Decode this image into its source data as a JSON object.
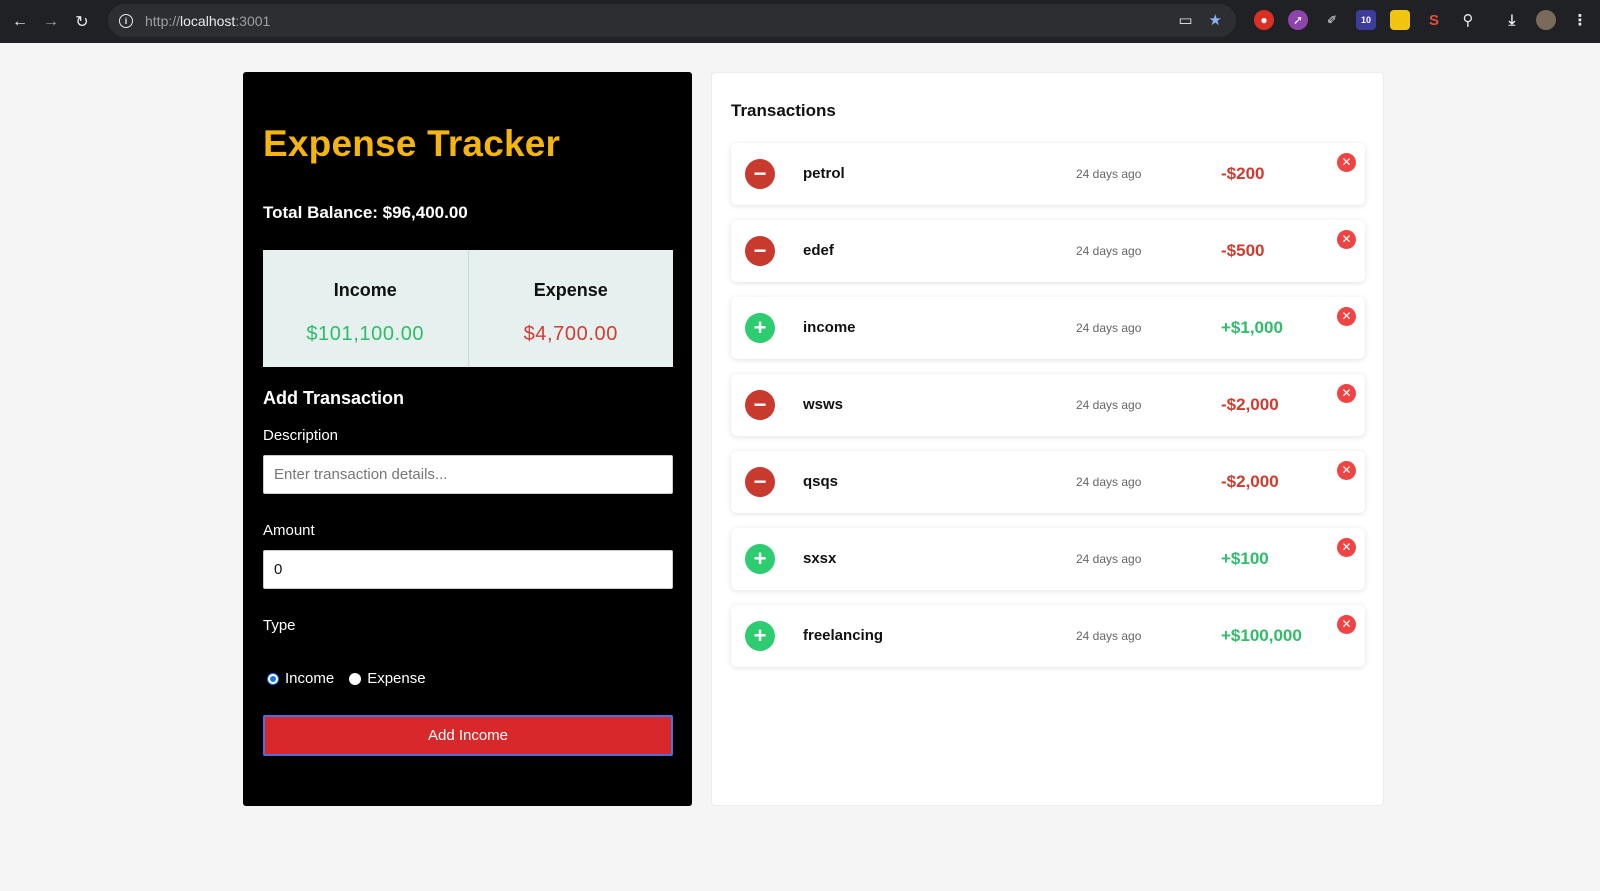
{
  "browser": {
    "url_scheme": "http://",
    "url_host": "localhost",
    "url_port": ":3001",
    "extension_badge": "10"
  },
  "app": {
    "title": "Expense Tracker",
    "total_balance": "Total Balance: $96,400.00"
  },
  "summary": {
    "income_label": "Income",
    "income_value": "$101,100.00",
    "expense_label": "Expense",
    "expense_value": "$4,700.00"
  },
  "form": {
    "heading": "Add Transaction",
    "description_label": "Description",
    "description_placeholder": "Enter transaction details...",
    "description_value": "",
    "amount_label": "Amount",
    "amount_value": "0",
    "type_label": "Type",
    "type_options": [
      "Income",
      "Expense"
    ],
    "type_selected": "Income",
    "submit_label": "Add Income"
  },
  "transactions": {
    "heading": "Transactions",
    "items": [
      {
        "desc": "petrol",
        "date": "24 days ago",
        "amount": "-$200",
        "type": "expense"
      },
      {
        "desc": "edef",
        "date": "24 days ago",
        "amount": "-$500",
        "type": "expense"
      },
      {
        "desc": "income",
        "date": "24 days ago",
        "amount": "+$1,000",
        "type": "income"
      },
      {
        "desc": "wsws",
        "date": "24 days ago",
        "amount": "-$2,000",
        "type": "expense"
      },
      {
        "desc": "qsqs",
        "date": "24 days ago",
        "amount": "-$2,000",
        "type": "expense"
      },
      {
        "desc": "sxsx",
        "date": "24 days ago",
        "amount": "+$100",
        "type": "income"
      },
      {
        "desc": "freelancing",
        "date": "24 days ago",
        "amount": "+$100,000",
        "type": "income"
      }
    ]
  },
  "colors": {
    "title_accent": "#f5b50f",
    "income": "#2ebd69",
    "expense": "#d63a32",
    "submit_button": "#d9282b"
  }
}
